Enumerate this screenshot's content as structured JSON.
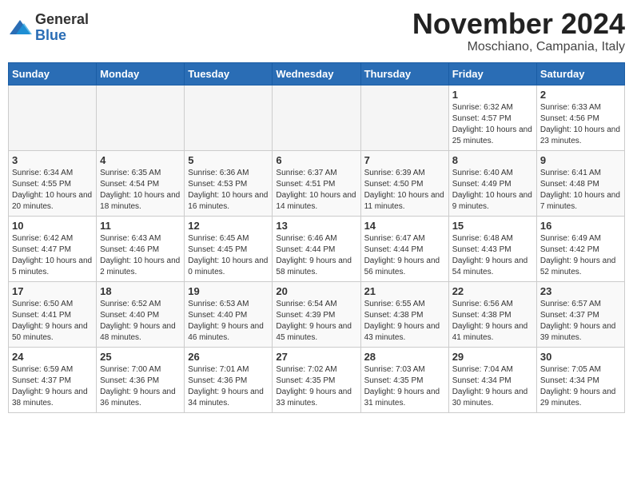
{
  "header": {
    "logo_general": "General",
    "logo_blue": "Blue",
    "month_title": "November 2024",
    "location": "Moschiano, Campania, Italy"
  },
  "days_of_week": [
    "Sunday",
    "Monday",
    "Tuesday",
    "Wednesday",
    "Thursday",
    "Friday",
    "Saturday"
  ],
  "weeks": [
    [
      {
        "day": "",
        "empty": true
      },
      {
        "day": "",
        "empty": true
      },
      {
        "day": "",
        "empty": true
      },
      {
        "day": "",
        "empty": true
      },
      {
        "day": "",
        "empty": true
      },
      {
        "day": "1",
        "sunrise": "6:32 AM",
        "sunset": "4:57 PM",
        "daylight": "10 hours and 25 minutes."
      },
      {
        "day": "2",
        "sunrise": "6:33 AM",
        "sunset": "4:56 PM",
        "daylight": "10 hours and 23 minutes."
      }
    ],
    [
      {
        "day": "3",
        "sunrise": "6:34 AM",
        "sunset": "4:55 PM",
        "daylight": "10 hours and 20 minutes."
      },
      {
        "day": "4",
        "sunrise": "6:35 AM",
        "sunset": "4:54 PM",
        "daylight": "10 hours and 18 minutes."
      },
      {
        "day": "5",
        "sunrise": "6:36 AM",
        "sunset": "4:53 PM",
        "daylight": "10 hours and 16 minutes."
      },
      {
        "day": "6",
        "sunrise": "6:37 AM",
        "sunset": "4:51 PM",
        "daylight": "10 hours and 14 minutes."
      },
      {
        "day": "7",
        "sunrise": "6:39 AM",
        "sunset": "4:50 PM",
        "daylight": "10 hours and 11 minutes."
      },
      {
        "day": "8",
        "sunrise": "6:40 AM",
        "sunset": "4:49 PM",
        "daylight": "10 hours and 9 minutes."
      },
      {
        "day": "9",
        "sunrise": "6:41 AM",
        "sunset": "4:48 PM",
        "daylight": "10 hours and 7 minutes."
      }
    ],
    [
      {
        "day": "10",
        "sunrise": "6:42 AM",
        "sunset": "4:47 PM",
        "daylight": "10 hours and 5 minutes."
      },
      {
        "day": "11",
        "sunrise": "6:43 AM",
        "sunset": "4:46 PM",
        "daylight": "10 hours and 2 minutes."
      },
      {
        "day": "12",
        "sunrise": "6:45 AM",
        "sunset": "4:45 PM",
        "daylight": "10 hours and 0 minutes."
      },
      {
        "day": "13",
        "sunrise": "6:46 AM",
        "sunset": "4:44 PM",
        "daylight": "9 hours and 58 minutes."
      },
      {
        "day": "14",
        "sunrise": "6:47 AM",
        "sunset": "4:44 PM",
        "daylight": "9 hours and 56 minutes."
      },
      {
        "day": "15",
        "sunrise": "6:48 AM",
        "sunset": "4:43 PM",
        "daylight": "9 hours and 54 minutes."
      },
      {
        "day": "16",
        "sunrise": "6:49 AM",
        "sunset": "4:42 PM",
        "daylight": "9 hours and 52 minutes."
      }
    ],
    [
      {
        "day": "17",
        "sunrise": "6:50 AM",
        "sunset": "4:41 PM",
        "daylight": "9 hours and 50 minutes."
      },
      {
        "day": "18",
        "sunrise": "6:52 AM",
        "sunset": "4:40 PM",
        "daylight": "9 hours and 48 minutes."
      },
      {
        "day": "19",
        "sunrise": "6:53 AM",
        "sunset": "4:40 PM",
        "daylight": "9 hours and 46 minutes."
      },
      {
        "day": "20",
        "sunrise": "6:54 AM",
        "sunset": "4:39 PM",
        "daylight": "9 hours and 45 minutes."
      },
      {
        "day": "21",
        "sunrise": "6:55 AM",
        "sunset": "4:38 PM",
        "daylight": "9 hours and 43 minutes."
      },
      {
        "day": "22",
        "sunrise": "6:56 AM",
        "sunset": "4:38 PM",
        "daylight": "9 hours and 41 minutes."
      },
      {
        "day": "23",
        "sunrise": "6:57 AM",
        "sunset": "4:37 PM",
        "daylight": "9 hours and 39 minutes."
      }
    ],
    [
      {
        "day": "24",
        "sunrise": "6:59 AM",
        "sunset": "4:37 PM",
        "daylight": "9 hours and 38 minutes."
      },
      {
        "day": "25",
        "sunrise": "7:00 AM",
        "sunset": "4:36 PM",
        "daylight": "9 hours and 36 minutes."
      },
      {
        "day": "26",
        "sunrise": "7:01 AM",
        "sunset": "4:36 PM",
        "daylight": "9 hours and 34 minutes."
      },
      {
        "day": "27",
        "sunrise": "7:02 AM",
        "sunset": "4:35 PM",
        "daylight": "9 hours and 33 minutes."
      },
      {
        "day": "28",
        "sunrise": "7:03 AM",
        "sunset": "4:35 PM",
        "daylight": "9 hours and 31 minutes."
      },
      {
        "day": "29",
        "sunrise": "7:04 AM",
        "sunset": "4:34 PM",
        "daylight": "9 hours and 30 minutes."
      },
      {
        "day": "30",
        "sunrise": "7:05 AM",
        "sunset": "4:34 PM",
        "daylight": "9 hours and 29 minutes."
      }
    ]
  ]
}
